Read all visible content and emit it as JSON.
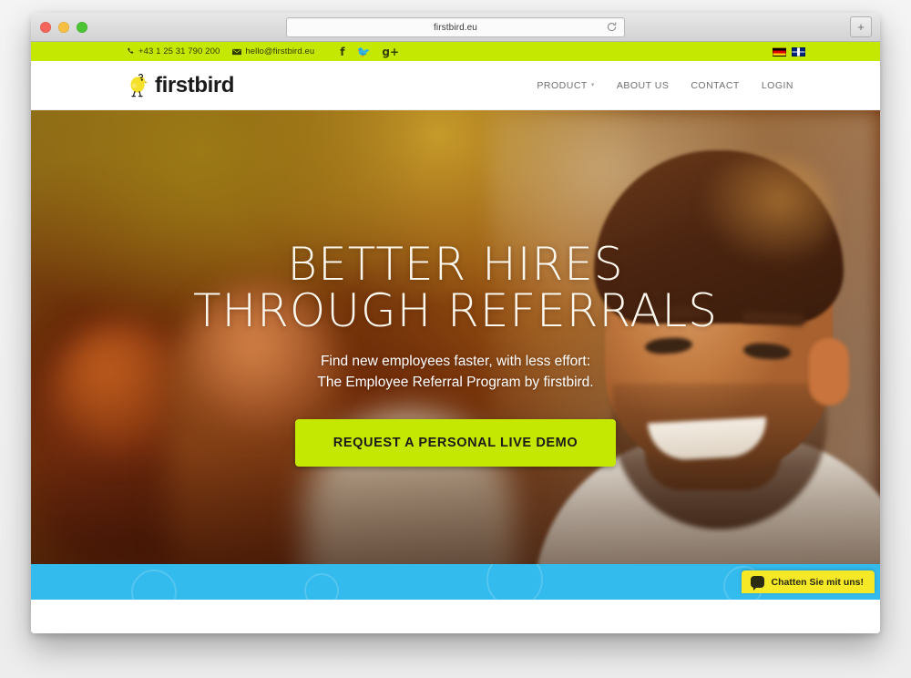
{
  "browser": {
    "url": "firstbird.eu",
    "reload_icon": "reload-icon",
    "new_tab_label": "+",
    "traffic_lights": [
      "close",
      "minimize",
      "zoom"
    ]
  },
  "topbar": {
    "phone": "+43 1 25 31 790 200",
    "email": "hello@firstbird.eu",
    "phone_icon": "phone-icon",
    "email_icon": "envelope-icon",
    "social": [
      {
        "name": "facebook-icon",
        "glyph": "f"
      },
      {
        "name": "twitter-icon",
        "glyph": "🐦"
      },
      {
        "name": "googleplus-icon",
        "glyph": "g+"
      }
    ],
    "languages": [
      {
        "name": "flag-de",
        "label": "Deutsch"
      },
      {
        "name": "flag-en",
        "label": "English"
      }
    ],
    "background_color": "#c5e802"
  },
  "header": {
    "logo_text": "firstbird",
    "logo_icon": "bird-logo-icon",
    "nav": [
      {
        "label": "PRODUCT",
        "has_caret": true,
        "caret": "▾"
      },
      {
        "label": "ABOUT US",
        "has_caret": false
      },
      {
        "label": "CONTACT",
        "has_caret": false
      },
      {
        "label": "LOGIN",
        "has_caret": false
      }
    ]
  },
  "hero": {
    "headline_line1": "BETTER HIRES",
    "headline_line2": "THROUGH REFERRALS",
    "subtitle_line1": "Find new employees faster, with less effort:",
    "subtitle_line2": "The Employee Referral Program by firstbird.",
    "cta_label": "REQUEST A PERSONAL LIVE DEMO",
    "cta_color": "#c5e802"
  },
  "footer": {
    "band_color": "#33bbee"
  },
  "chat": {
    "label": "Chatten Sie mit uns!",
    "icon": "chat-bubble-icon",
    "background_color": "#f5e827"
  }
}
